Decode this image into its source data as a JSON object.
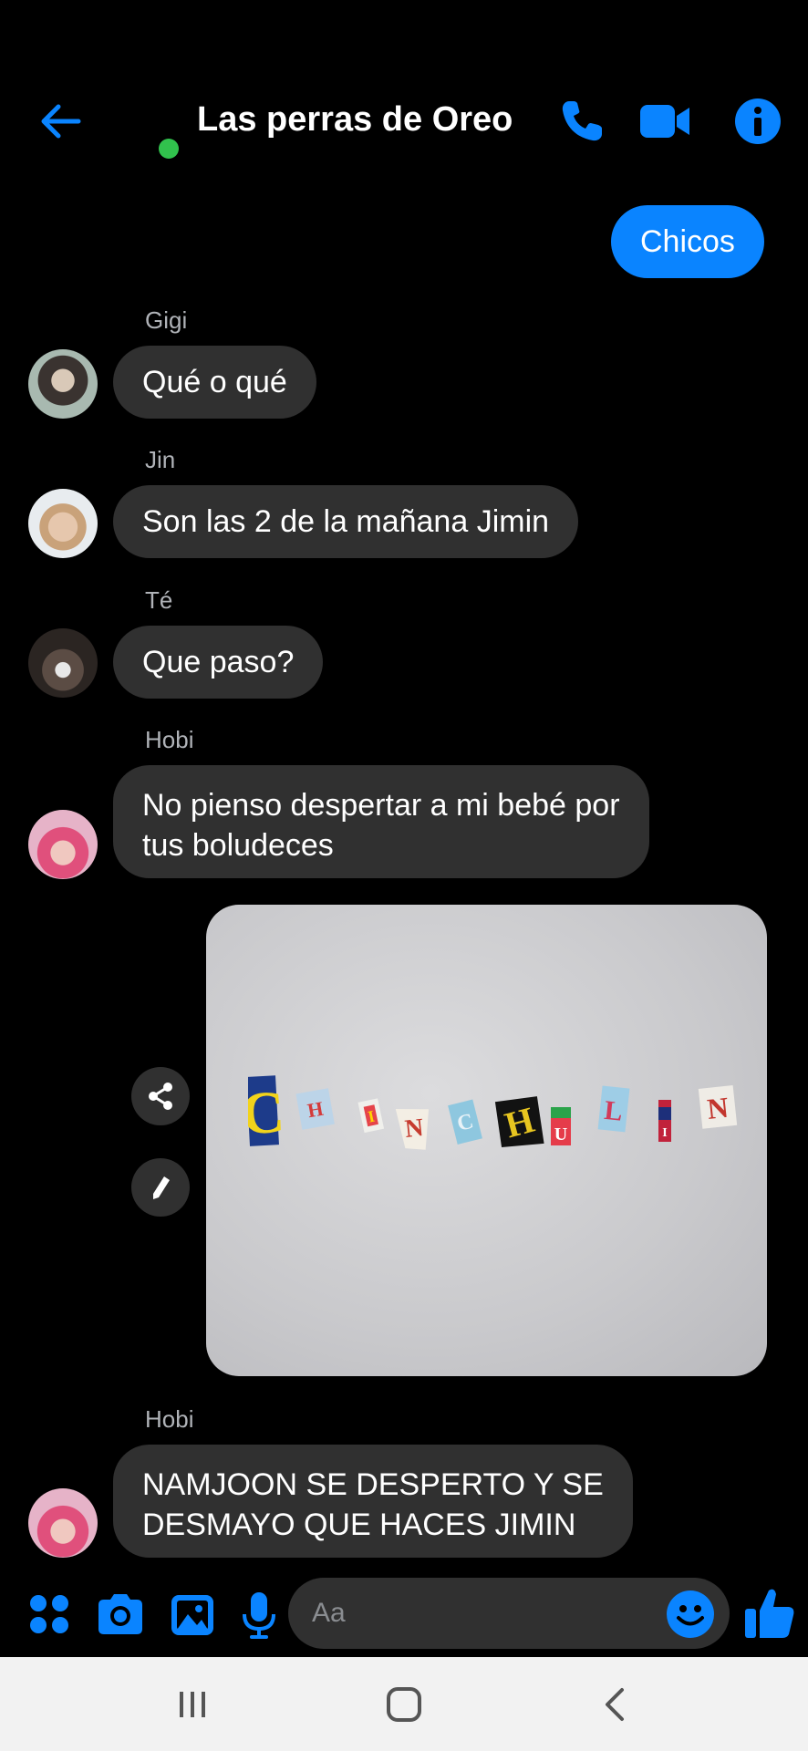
{
  "header": {
    "title": "Las perras de Oreo",
    "accent_color": "#0a84ff",
    "online_color": "#31c24d",
    "icons": [
      "back-arrow-icon",
      "phone-icon",
      "video-camera-icon",
      "info-icon"
    ]
  },
  "messages": {
    "outgoing_1": "Chicos",
    "m1": {
      "sender": "Gigi",
      "text": "Qué o qué"
    },
    "m2": {
      "sender": "Jin",
      "text": "Son las 2 de la mañana Jimin"
    },
    "m3": {
      "sender": "Té",
      "text": "Que paso?"
    },
    "m4": {
      "sender": "Hobi",
      "line1": "No pienso despertar a mi bebé por",
      "line2": "tus boludeces"
    },
    "photo_letters": [
      "C",
      "H",
      "I",
      "N",
      "C",
      "H",
      "U",
      "L",
      "I",
      "N"
    ],
    "m5": {
      "sender": "Hobi",
      "line1": "NAMJOON SE DESPERTO Y SE",
      "line2": "DESMAYO QUE HACES JIMIN"
    }
  },
  "composer": {
    "placeholder": "Aa",
    "icons": [
      "apps-icon",
      "camera-icon",
      "gallery-icon",
      "microphone-icon",
      "emoji-icon",
      "thumbs-up-icon"
    ]
  },
  "navbar": {
    "icons": [
      "recent-apps-icon",
      "home-icon",
      "back-icon"
    ]
  }
}
